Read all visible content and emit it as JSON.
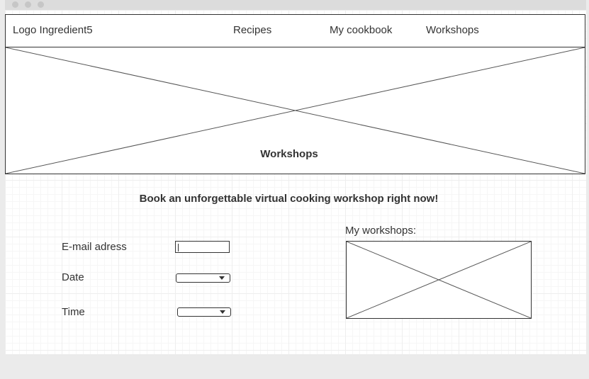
{
  "nav": {
    "logo": "Logo Ingredient5",
    "links": [
      "Recipes",
      "My cookbook",
      "Workshops"
    ]
  },
  "hero": {
    "title": "Workshops"
  },
  "main": {
    "headline": "Book an unforgettable virtual cooking workshop right now!",
    "form": {
      "email_label": "E-mail adress",
      "date_label": "Date",
      "time_label": "Time"
    },
    "my_workshops_label": "My workshops:"
  }
}
